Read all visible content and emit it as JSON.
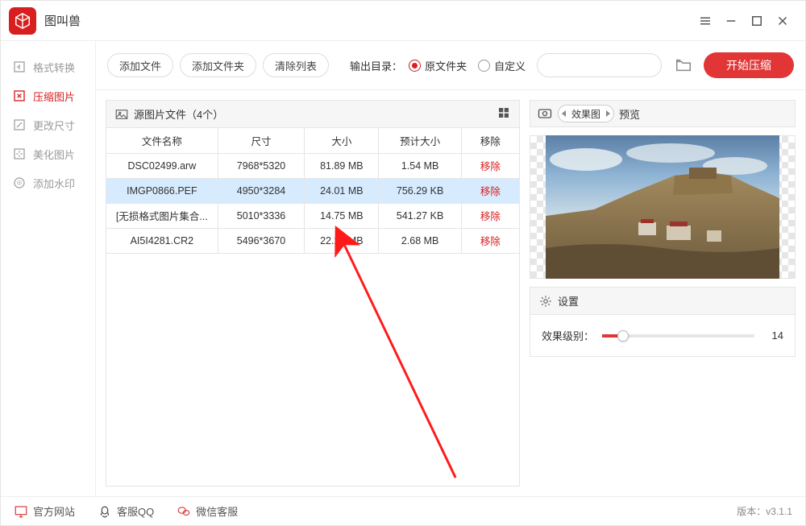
{
  "app": {
    "title": "图叫兽"
  },
  "sidebar": {
    "items": [
      {
        "label": "格式转换"
      },
      {
        "label": "压缩图片"
      },
      {
        "label": "更改尺寸"
      },
      {
        "label": "美化图片"
      },
      {
        "label": "添加水印"
      }
    ],
    "active_index": 1
  },
  "toolbar": {
    "add_file": "添加文件",
    "add_folder": "添加文件夹",
    "clear_list": "清除列表",
    "output_label": "输出目录：",
    "radio_source": "原文件夹",
    "radio_custom": "自定义",
    "output_path": "",
    "start_button": "开始压缩"
  },
  "table": {
    "title": "源图片文件（4个）",
    "columns": {
      "name": "文件名称",
      "dim": "尺寸",
      "size": "大小",
      "est": "预计大小",
      "del": "移除"
    },
    "remove_label": "移除",
    "rows": [
      {
        "name": "DSC02499.arw",
        "dim": "7968*5320",
        "size": "81.89 MB",
        "est": "1.54 MB",
        "selected": false
      },
      {
        "name": "IMGP0866.PEF",
        "dim": "4950*3284",
        "size": "24.01 MB",
        "est": "756.29 KB",
        "selected": true
      },
      {
        "name": "[无损格式图片集合...",
        "dim": "5010*3336",
        "size": "14.75 MB",
        "est": "541.27 KB",
        "selected": false
      },
      {
        "name": "AI5I4281.CR2",
        "dim": "5496*3670",
        "size": "22.28 MB",
        "est": "2.68 MB",
        "selected": false
      }
    ]
  },
  "preview": {
    "dropdown": "效果图",
    "label": "预览",
    "settings_label": "设置",
    "slider_label": "效果级别：",
    "slider_value": 14,
    "slider_max": 100
  },
  "footer": {
    "site": "官方网站",
    "qq": "客服QQ",
    "wechat": "微信客服",
    "version": "版本：v3.1.1"
  }
}
